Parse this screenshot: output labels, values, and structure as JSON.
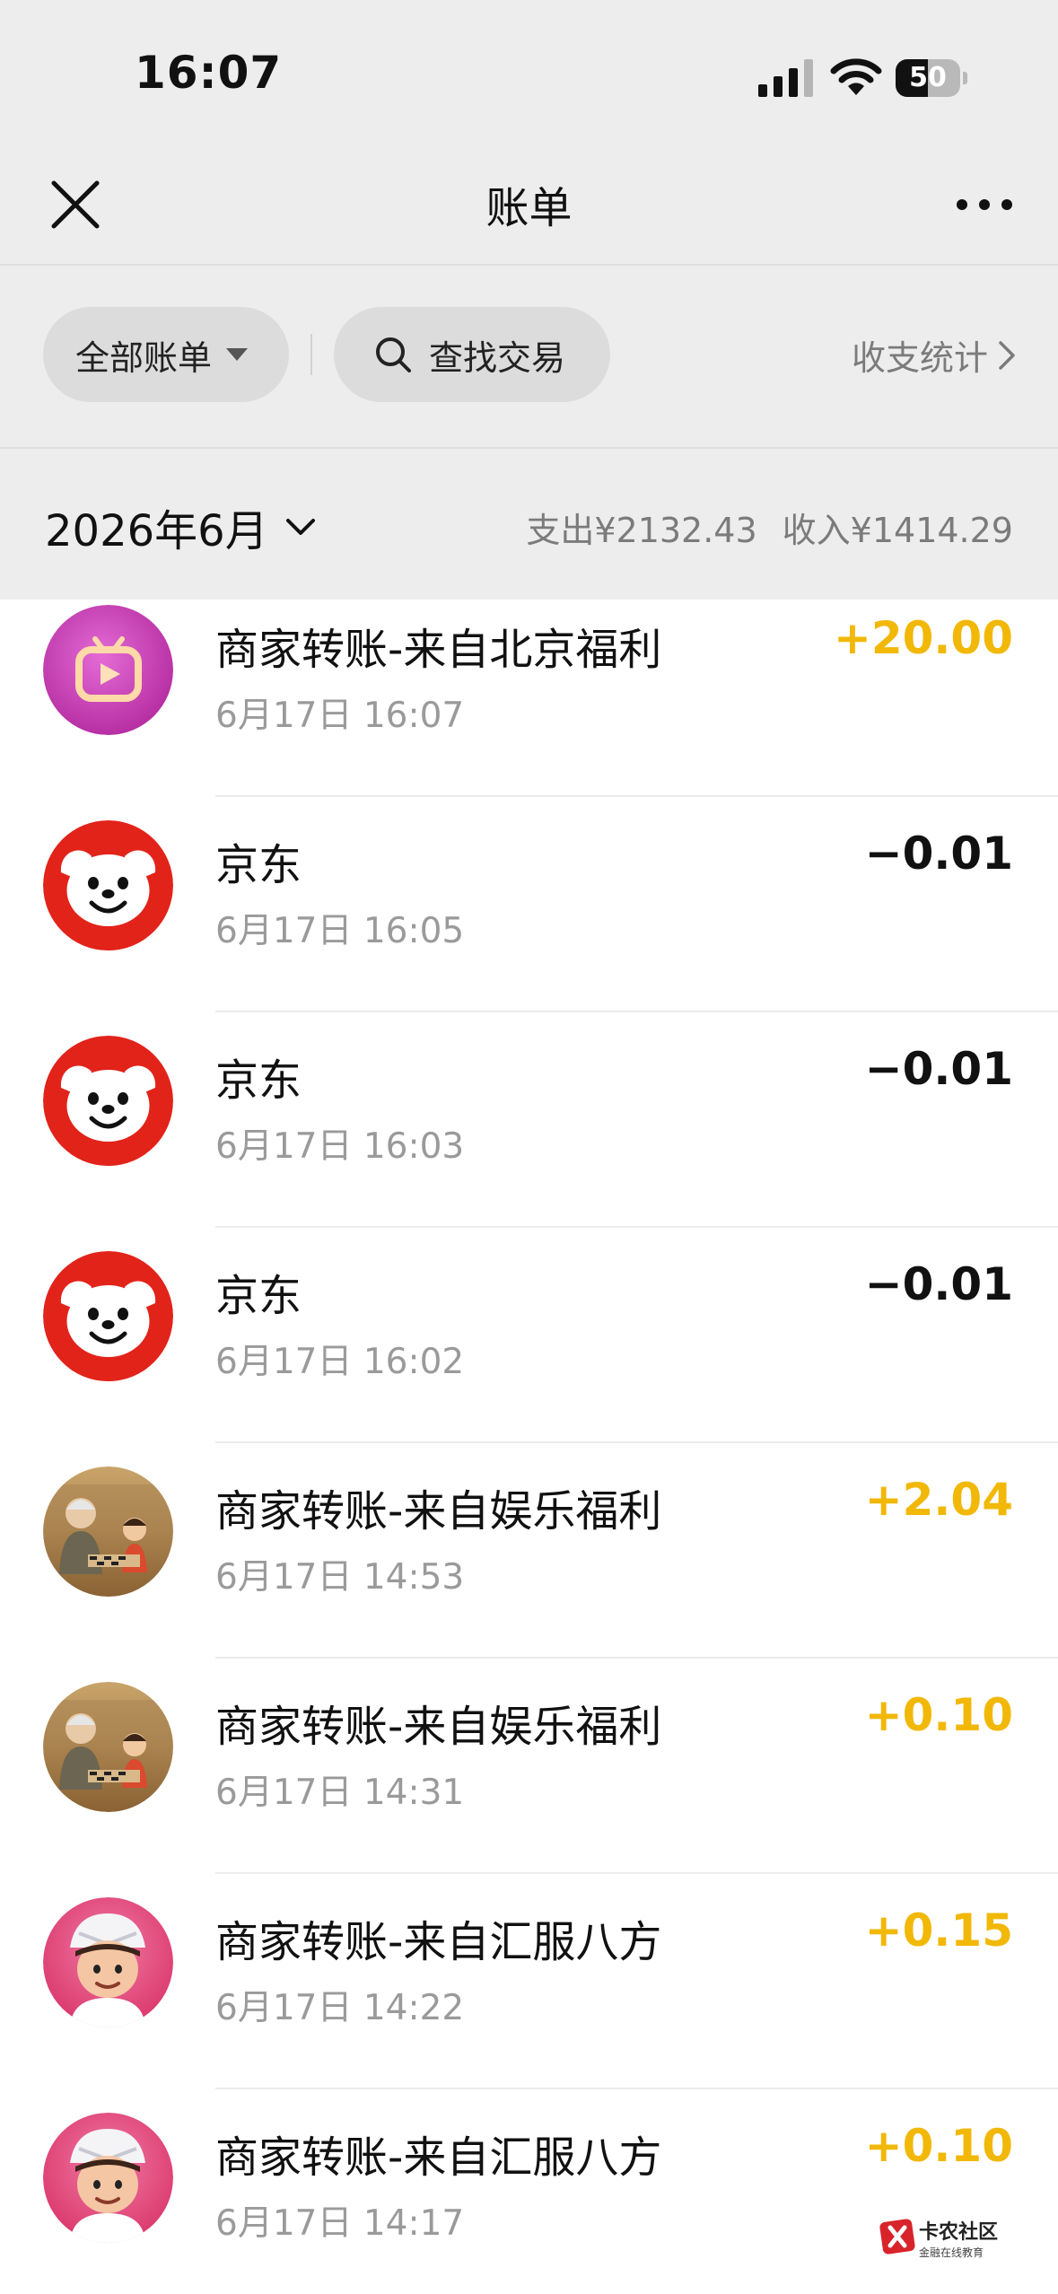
{
  "status_bar": {
    "time": "16:07",
    "battery": "50",
    "battery_level": 0.5
  },
  "nav": {
    "title": "账单"
  },
  "filters": {
    "all_bills": "全部账单",
    "search": "查找交易",
    "stats": "收支统计"
  },
  "month_bar": {
    "month": "2026年6月",
    "expense": "支出¥2132.43",
    "income": "收入¥1414.29"
  },
  "transactions": [
    {
      "title": "商家转账-来自北京福利",
      "time": "6月17日 16:07",
      "amount": "+20.00",
      "type": "income",
      "avatar": "tv-app-icon"
    },
    {
      "title": "京东",
      "time": "6月17日 16:05",
      "amount": "−0.01",
      "type": "expense",
      "avatar": "jd-dog-icon"
    },
    {
      "title": "京东",
      "time": "6月17日 16:03",
      "amount": "−0.01",
      "type": "expense",
      "avatar": "jd-dog-icon"
    },
    {
      "title": "京东",
      "time": "6月17日 16:02",
      "amount": "−0.01",
      "type": "expense",
      "avatar": "jd-dog-icon"
    },
    {
      "title": "商家转账-来自娱乐福利",
      "time": "6月17日 14:53",
      "amount": "+2.04",
      "type": "income",
      "avatar": "chess-players-icon"
    },
    {
      "title": "商家转账-来自娱乐福利",
      "time": "6月17日 14:31",
      "amount": "+0.10",
      "type": "income",
      "avatar": "chess-players-icon"
    },
    {
      "title": "商家转账-来自汇服八方",
      "time": "6月17日 14:22",
      "amount": "+0.15",
      "type": "income",
      "avatar": "cartoon-chef-icon"
    },
    {
      "title": "商家转账-来自汇服八方",
      "time": "6月17日 14:17",
      "amount": "+0.10",
      "type": "income",
      "avatar": "cartoon-chef-icon"
    }
  ],
  "watermark": {
    "name": "卡农社区",
    "tagline": "金融在线教育"
  },
  "colors": {
    "income": "#f2b807",
    "expense": "#111111",
    "header_bg": "#ededed",
    "jd_red": "#e2231a",
    "tv_purple": "#c93bb8"
  }
}
